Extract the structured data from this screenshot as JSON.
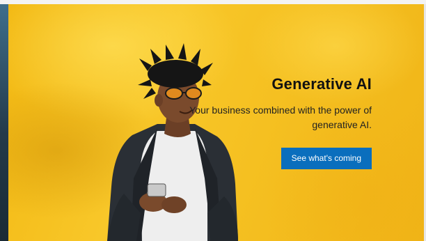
{
  "hero": {
    "title": "Generative AI",
    "subtitle_line1": "Your business combined with the power of",
    "subtitle_line2": "generative AI.",
    "cta_label": "See what's coming",
    "background_color": "#f5c021",
    "cta_color": "#0a6ebd"
  }
}
